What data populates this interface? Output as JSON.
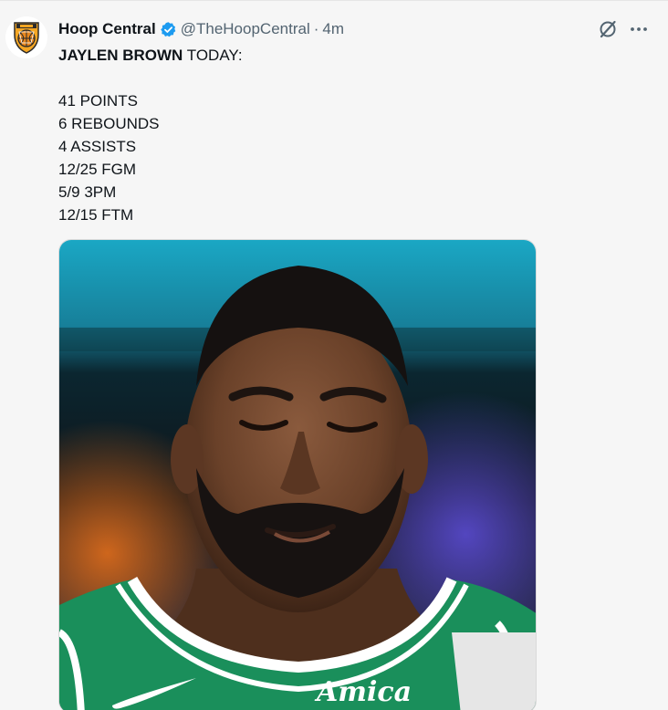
{
  "tweet": {
    "author_name": "Hoop Central",
    "handle": "@TheHoopCentral",
    "separator": "·",
    "time_ago": "4m",
    "headline_bold": "JAYLEN BROWN",
    "headline_rest": " TODAY:",
    "stats": [
      "41 POINTS",
      "6 REBOUNDS",
      "4 ASSISTS",
      "12/25 FGM",
      "5/9 3PM",
      "12/15 FTM"
    ],
    "jersey_text": "Amica"
  },
  "icons": {
    "verified": "verified-badge-icon",
    "grok": "grok-icon",
    "more": "more-options-icon"
  },
  "colors": {
    "accent": "#1d9bf0",
    "secondary_text": "#536471",
    "jersey_green": "#1a8f5b"
  }
}
